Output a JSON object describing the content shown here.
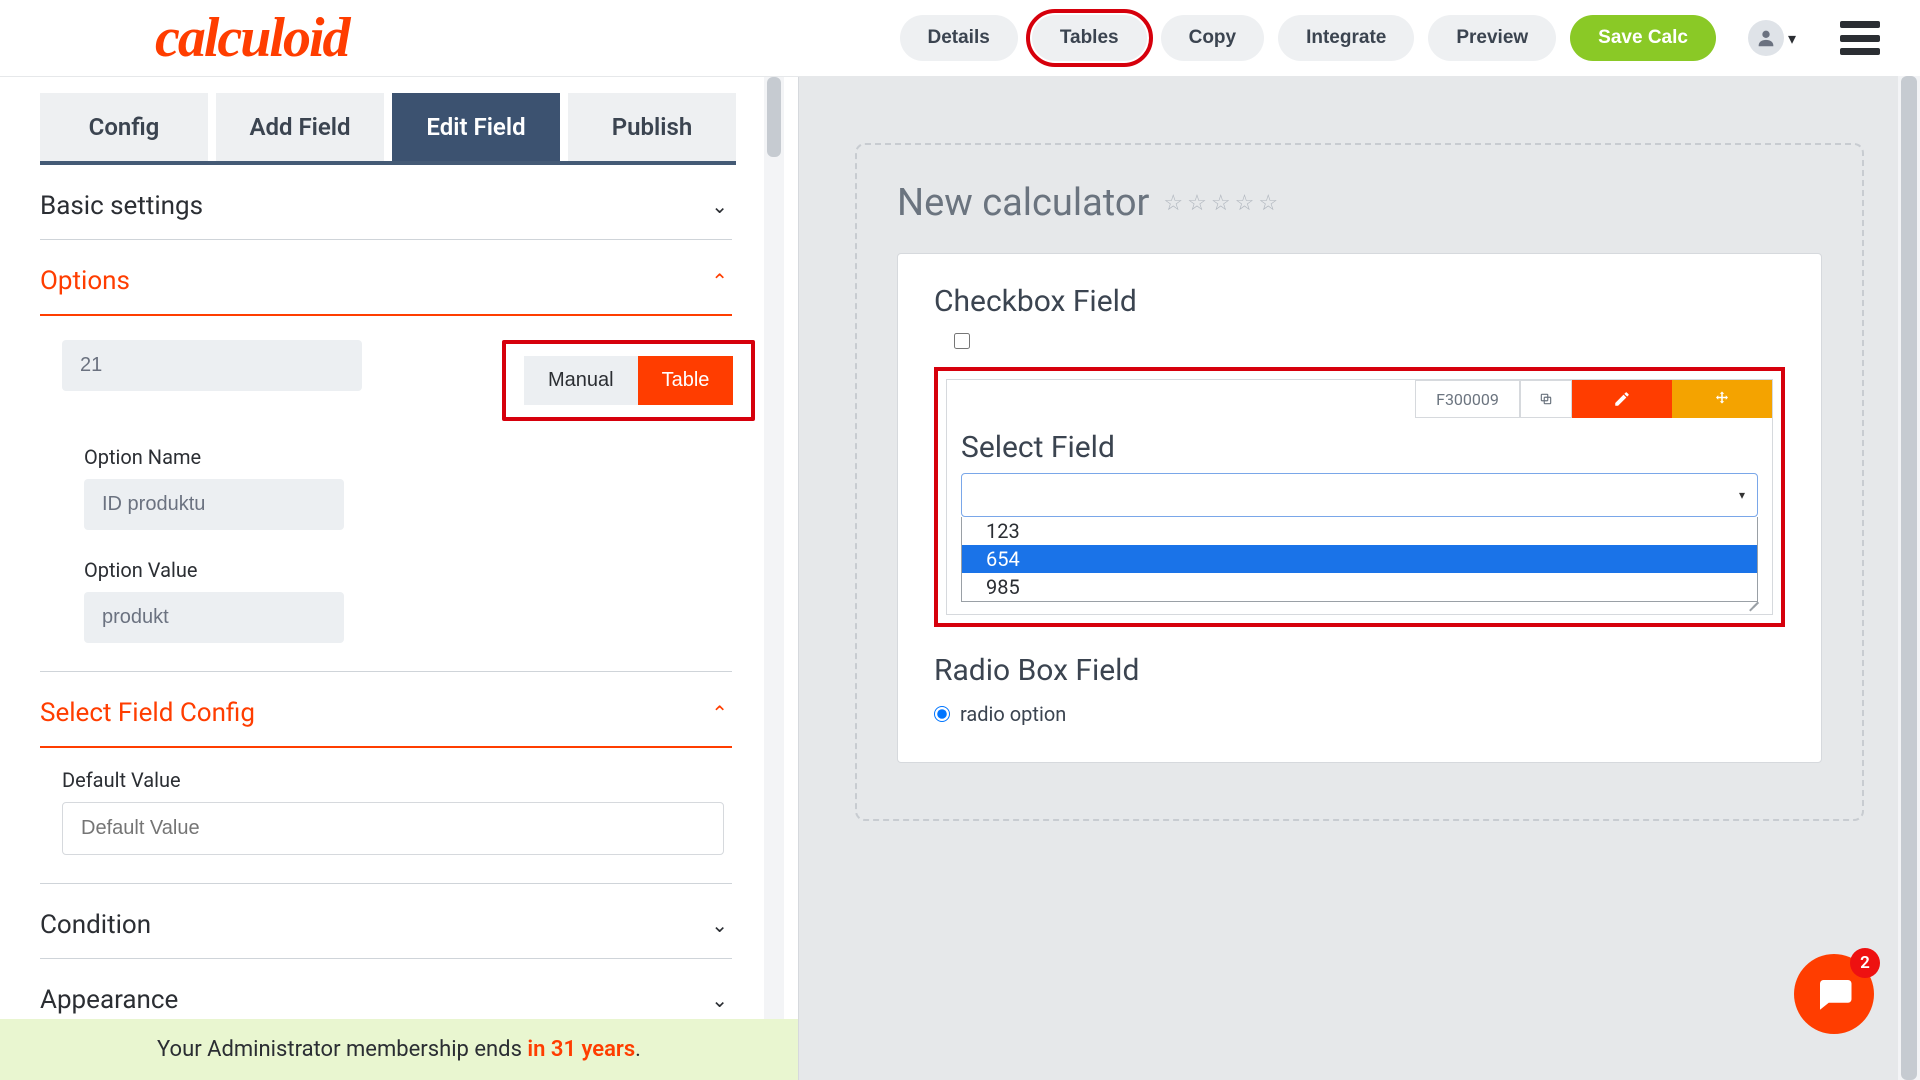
{
  "brand": "calculoid",
  "nav": {
    "details": "Details",
    "tables": "Tables",
    "copy": "Copy",
    "integrate": "Integrate",
    "preview": "Preview",
    "save": "Save Calc"
  },
  "subtabs": {
    "config": "Config",
    "add_field": "Add Field",
    "edit_field": "Edit Field",
    "publish": "Publish"
  },
  "sections": {
    "basic": "Basic settings",
    "options": "Options",
    "select_cfg": "Select Field Config",
    "condition": "Condition",
    "appearance": "Appearance"
  },
  "options": {
    "count_value": "21",
    "toggle_manual": "Manual",
    "toggle_table": "Table",
    "name_label": "Option Name",
    "name_value": "ID produktu",
    "value_label": "Option Value",
    "value_value": "produkt"
  },
  "select_cfg": {
    "default_label": "Default Value",
    "default_placeholder": "Default Value"
  },
  "preview": {
    "calc_title": "New calculator",
    "checkbox_title": "Checkbox Field",
    "select_title": "Select Field",
    "field_id": "F300009",
    "drop_items": [
      "123",
      "654",
      "985"
    ],
    "radio_title": "Radio Box Field",
    "radio_option": "radio option"
  },
  "notice": {
    "pre": "Your Administrator membership ends ",
    "emph": "in 31 years",
    "post": "."
  },
  "fab_badge": "2"
}
